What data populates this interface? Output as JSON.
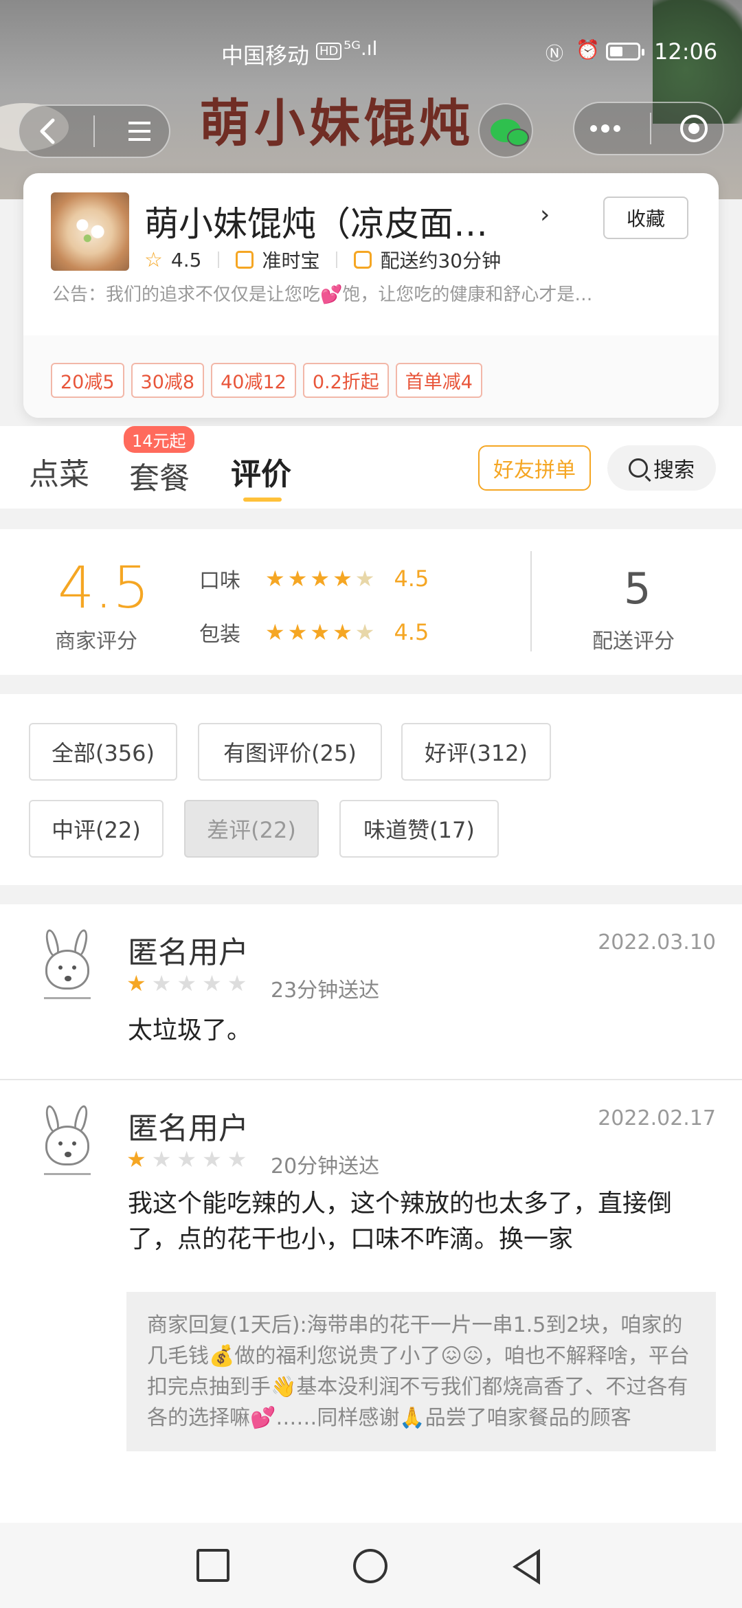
{
  "status_bar": {
    "carrier": "中国移动",
    "hd": "HD",
    "signal": "⁵ᴳ.ıl",
    "time": "12:06"
  },
  "banner": {
    "sign_text": "萌小妹馄炖"
  },
  "store": {
    "name": "萌小妹馄炖（凉皮面…",
    "favorite_label": "收藏",
    "rating": "4.5",
    "badge": "准时宝",
    "delivery": "配送约30分钟",
    "notice": "公告：我们的追求不仅仅是让您吃💕饱，让您吃的健康和舒心才是…",
    "promos": [
      "20减5",
      "30减8",
      "40减12",
      "0.2折起",
      "首单减4"
    ]
  },
  "tabs": {
    "order": "点菜",
    "combo": "套餐",
    "combo_badge": "14元起",
    "reviews": "评价",
    "group_buy": "好友拼单",
    "search": "搜索"
  },
  "rating_summary": {
    "merchant_score": "4.5",
    "merchant_label": "商家评分",
    "taste_label": "口味",
    "taste_score": "4.5",
    "taste_stars": 4.5,
    "pack_label": "包装",
    "pack_score": "4.5",
    "pack_stars": 4.5,
    "delivery_score": "5",
    "delivery_label": "配送评分"
  },
  "filters": [
    {
      "label": "全部(356)",
      "active": false
    },
    {
      "label": "有图评价(25)",
      "active": false
    },
    {
      "label": "好评(312)",
      "active": false
    },
    {
      "label": "中评(22)",
      "active": false
    },
    {
      "label": "差评(22)",
      "active": true
    },
    {
      "label": "味道赞(17)",
      "active": false
    }
  ],
  "reviews": [
    {
      "user": "匿名用户",
      "date": "2022.03.10",
      "stars": 1,
      "delivery_time": "23分钟送达",
      "text": "太垃圾了。"
    },
    {
      "user": "匿名用户",
      "date": "2022.02.17",
      "stars": 1,
      "delivery_time": "20分钟送达",
      "text": "我这个能吃辣的人，这个辣放的也太多了，直接倒了，点的花干也小，口味不咋滴。换一家",
      "reply": "商家回复(1天后):海带串的花干一片一串1.5到2块，咱家的几毛钱💰做的福利您说贵了小了😖😖，咱也不解释啥，平台扣完点抽到手👋基本没利润不亏我们都烧高香了、不过各有各的选择嘛💕……同样感谢🙏品尝了咱家餐品的顾客"
    }
  ]
}
